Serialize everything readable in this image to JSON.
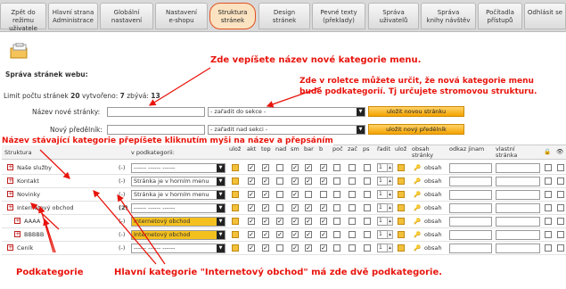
{
  "tabs": [
    {
      "label": "Zpět do režimu\nuživatele",
      "active": false
    },
    {
      "label": "Hlavní strana\nAdministrace",
      "active": false
    },
    {
      "label": "Globální\nnastavení",
      "active": false
    },
    {
      "label": "Nastavení\ne-shopu",
      "active": false
    },
    {
      "label": "Struktura\nstránek",
      "active": true
    },
    {
      "label": "Design\nstránek",
      "active": false
    },
    {
      "label": "Pevné texty\n(překlady)",
      "active": false
    },
    {
      "label": "Správa\nuživatelů",
      "active": false
    },
    {
      "label": "Správa\nknihy návštěv",
      "active": false
    },
    {
      "label": "Počítadla\npřístupů",
      "active": false
    },
    {
      "label": "Odhlásit se",
      "active": false
    }
  ],
  "page": {
    "title": "Správa stránek webu:",
    "limit_prefix": "Limit počtu stránek ",
    "limit": "20",
    "created_label": " vytvořeno: ",
    "created": "7",
    "remaining_label": " zbývá: ",
    "remaining": "13"
  },
  "form": {
    "new_page_label": "Název nové stránky:",
    "new_page_value": "",
    "section_select": "- zařadit do sekce -",
    "new_page_button": "uložit novou stránku",
    "new_parent_label": "Nový předělník:",
    "new_parent_value": "",
    "parent_select": "- zařadit nad sekci -",
    "new_parent_button": "uložit nový předělník"
  },
  "annotations": {
    "a1": "Zde  vepíšete  název nové kategorie menu.",
    "a2_line1": "Zde v roletce můžete určit, že nová kategorie menu",
    "a2_line2": "bude podkategorií. Tj určujete stromovou strukturu.",
    "a3": "Název stávající kategorie přepíšete kliknutím myši na název a přepsáním",
    "a4": "Podkategorie",
    "a5": "Hlavní kategorie \"Internetový obchod\" má zde dvě podkategorie."
  },
  "table": {
    "headers": {
      "structure": "Struktura",
      "subcategory": "v podkategorii:",
      "save": "ulož",
      "akt": "akt",
      "top": "top",
      "nad": "nad",
      "sm": "sm",
      "bar": "bar",
      "b": "b",
      "poc": "poč",
      "zac": "zač",
      "ps": "ps",
      "order": "řadit",
      "save2": "ulož",
      "content": "obsah\nstránky",
      "link": "odkaz jinam",
      "own_page": "vlastní\nstránka"
    },
    "content_label": "obsah",
    "rows": [
      {
        "name": "Naše služby",
        "count": "(-)",
        "sub": "------ ------ ------",
        "highlight": false,
        "checks": [
          1,
          1,
          0,
          1,
          1,
          1,
          0,
          0,
          0,
          1
        ],
        "order": "1"
      },
      {
        "name": "Kontakt",
        "count": "(-)",
        "sub": "Stránka je v horním menu",
        "highlight": false,
        "checks": [
          1,
          1,
          0,
          1,
          1,
          1,
          0,
          0,
          0,
          1
        ],
        "order": "1"
      },
      {
        "name": "Novinky",
        "count": "(-)",
        "sub": "Stránka je v horním menu",
        "highlight": false,
        "checks": [
          1,
          1,
          0,
          1,
          0,
          0,
          0,
          0,
          0,
          1
        ],
        "order": "1"
      },
      {
        "name": "Internetový obchod",
        "count": "(2)",
        "sub": "------ ------ ------",
        "highlight": false,
        "checks": [
          1,
          1,
          0,
          1,
          1,
          1,
          0,
          0,
          0,
          1
        ],
        "order": "1"
      },
      {
        "name": "AAAA",
        "count": "(-)",
        "sub": "Internetový obchod",
        "highlight": true,
        "checks": [
          1,
          1,
          1,
          1,
          1,
          1,
          0,
          0,
          0,
          1
        ],
        "order": "1"
      },
      {
        "name": "BBBBB",
        "count": "(-)",
        "sub": "Internetový obchod",
        "highlight": true,
        "checks": [
          1,
          1,
          1,
          1,
          1,
          1,
          0,
          0,
          0,
          1
        ],
        "order": "1"
      },
      {
        "name": "Ceník",
        "count": "(-)",
        "sub": "------ ------ ------",
        "highlight": false,
        "checks": [
          1,
          1,
          0,
          1,
          1,
          1,
          0,
          0,
          0,
          1
        ],
        "order": "1"
      }
    ]
  },
  "colors": {
    "annotation": "#e8140c",
    "accent": "#f4a300",
    "active_tab_border": "#e0501e"
  }
}
